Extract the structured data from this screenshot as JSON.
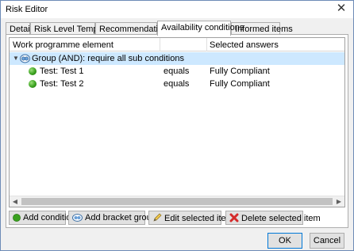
{
  "window": {
    "title": "Risk Editor"
  },
  "tabs": [
    {
      "label": "Details"
    },
    {
      "label": "Risk Level Template"
    },
    {
      "label": "Recommendations"
    },
    {
      "label": "Availability conditions"
    },
    {
      "label": "Informed items"
    }
  ],
  "grid": {
    "columns": [
      "Work programme element",
      "",
      "Selected answers"
    ],
    "group": {
      "label": "Group (AND): require all sub conditions"
    },
    "rows": [
      {
        "element": "Test: Test 1",
        "operator": "equals",
        "answer": "Fully Compliant"
      },
      {
        "element": "Test: Test 2",
        "operator": "equals",
        "answer": "Fully Compliant"
      }
    ]
  },
  "actions": {
    "add_condition": "Add condition",
    "add_bracket_group": "Add bracket group",
    "edit_selected": "Edit selected item",
    "delete_selected": "Delete selected item"
  },
  "footer": {
    "ok": "OK",
    "cancel": "Cancel"
  },
  "colors": {
    "selection": "#cde8ff",
    "status_green": "#3aa11f",
    "delete_red": "#d42a2a"
  },
  "icons": {
    "close": "close-icon",
    "group": "group-icon",
    "condition": "green-dot-icon",
    "add": "green-plus-icon",
    "bracket": "bracket-icon",
    "edit": "pencil-icon",
    "delete": "red-x-icon"
  }
}
